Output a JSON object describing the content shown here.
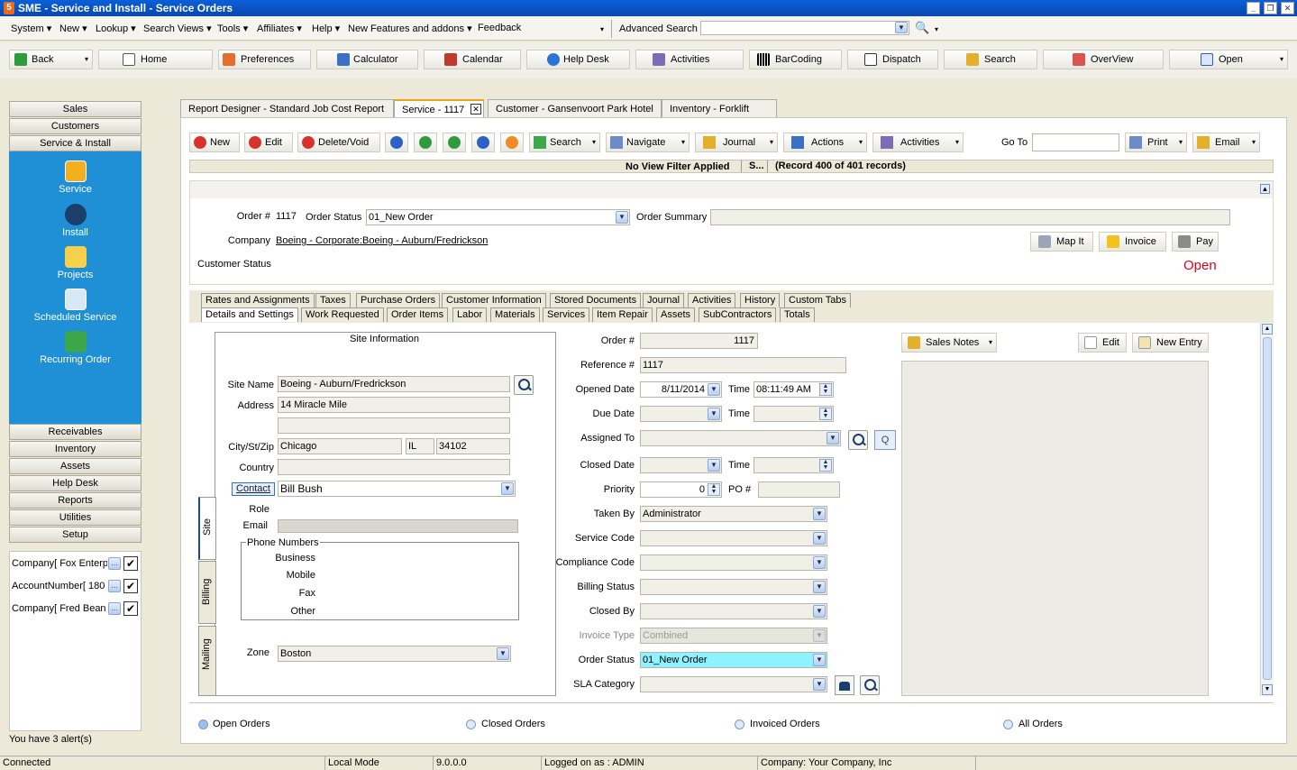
{
  "window": {
    "title": "SME - Service and Install - Service Orders"
  },
  "menu": {
    "items": [
      "System",
      "New",
      "Lookup",
      "Search Views",
      "Tools",
      "Affiliates",
      "Help",
      "New Features and addons",
      "Feedback"
    ],
    "advanced_search_label": "Advanced Search"
  },
  "toolbar": {
    "items": [
      "Back",
      "Home",
      "Preferences",
      "Calculator",
      "Calendar",
      "Help Desk",
      "Activities",
      "BarCoding",
      "Dispatch",
      "Search",
      "OverView",
      "Open"
    ]
  },
  "sidebar": {
    "top_sections": [
      "Sales",
      "Customers",
      "Service & Install"
    ],
    "nav_items": [
      "Service",
      "Install",
      "Projects",
      "Scheduled Service",
      "Recurring Order"
    ],
    "bottom_sections": [
      "Receivables",
      "Inventory",
      "Assets",
      "Help Desk",
      "Reports",
      "Utilities",
      "Setup"
    ],
    "filters": [
      "Company[ Fox Enterp",
      "AccountNumber[ 180",
      "Company[ Fred Bean"
    ],
    "alerts": "You have 3 alert(s)"
  },
  "doc_tabs": [
    "Report Designer - Standard Job Cost Report",
    "Service - 1117",
    "Customer - Gansenvoort Park Hotel",
    "Inventory - Forklift"
  ],
  "action_toolbar": {
    "new": "New",
    "edit": "Edit",
    "delete": "Delete/Void",
    "search": "Search",
    "navigate": "Navigate",
    "journal": "Journal",
    "actions": "Actions",
    "activities": "Activities",
    "goto": "Go To",
    "print": "Print",
    "email": "Email"
  },
  "info_bar": {
    "filter": "No View Filter Applied",
    "s": "S...",
    "record": "(Record 400 of 401 records)"
  },
  "header": {
    "order_label": "Order #",
    "order_value": "1117",
    "order_status_label": "Order Status",
    "order_status_value": "01_New Order",
    "order_summary_label": "Order Summary",
    "company_label": "Company",
    "company_value": "Boeing - Corporate:Boeing - Auburn/Fredrickson",
    "customer_status_label": "Customer Status",
    "map_it": "Map It",
    "invoice": "Invoice",
    "pay": "Pay",
    "status": "Open"
  },
  "sub_tabs_row1": [
    "Rates and Assignments",
    "Taxes",
    "Purchase Orders",
    "Customer Information",
    "Stored Documents",
    "Journal",
    "Activities",
    "History",
    "Custom Tabs"
  ],
  "sub_tabs_row2": [
    "Details and Settings",
    "Work Requested",
    "Order Items",
    "Labor",
    "Materials",
    "Services",
    "Item Repair",
    "Assets",
    "SubContractors",
    "Totals"
  ],
  "site": {
    "title": "Site Information",
    "site_name_label": "Site Name",
    "site_name": "Boeing - Auburn/Fredrickson",
    "address_label": "Address",
    "address": "14 Miracle Mile",
    "city_label": "City/St/Zip",
    "city": "Chicago",
    "state": "IL",
    "zip": "34102",
    "country_label": "Country",
    "contact_label": "Contact",
    "contact": "Bill Bush",
    "role_label": "Role",
    "email_label": "Email",
    "phone_title": "Phone Numbers",
    "business": "Business",
    "mobile": "Mobile",
    "fax": "Fax",
    "other": "Other",
    "zone_label": "Zone",
    "zone": "Boston",
    "vtabs": [
      "Site",
      "Billing",
      "Mailing"
    ]
  },
  "details": {
    "order_label": "Order #",
    "order": "1117",
    "reference_label": "Reference #",
    "reference": "1117",
    "opened_label": "Opened Date",
    "opened_date": "8/11/2014",
    "time_label": "Time",
    "opened_time": "08:11:49 AM",
    "due_label": "Due Date",
    "assigned_label": "Assigned To",
    "closed_label": "Closed Date",
    "priority_label": "Priority",
    "priority": "0",
    "po_label": "PO #",
    "taken_label": "Taken By",
    "taken_by": "Administrator",
    "service_code_label": "Service Code",
    "compliance_label": "Compliance Code",
    "billing_status_label": "Billing Status",
    "closed_by_label": "Closed By",
    "invoice_type_label": "Invoice Type",
    "invoice_type": "Combined",
    "order_status_label": "Order Status",
    "order_status": "01_New Order",
    "sla_label": "SLA Category",
    "q": "Q"
  },
  "notes": {
    "sales_notes": "Sales Notes",
    "edit": "Edit",
    "new_entry": "New Entry"
  },
  "radios": [
    "Open Orders",
    "Closed Orders",
    "Invoiced Orders",
    "All Orders"
  ],
  "statusbar": [
    "Connected",
    "Local Mode",
    "9.0.0.0",
    "Logged on as : ADMIN",
    "Company: Your Company, Inc"
  ]
}
